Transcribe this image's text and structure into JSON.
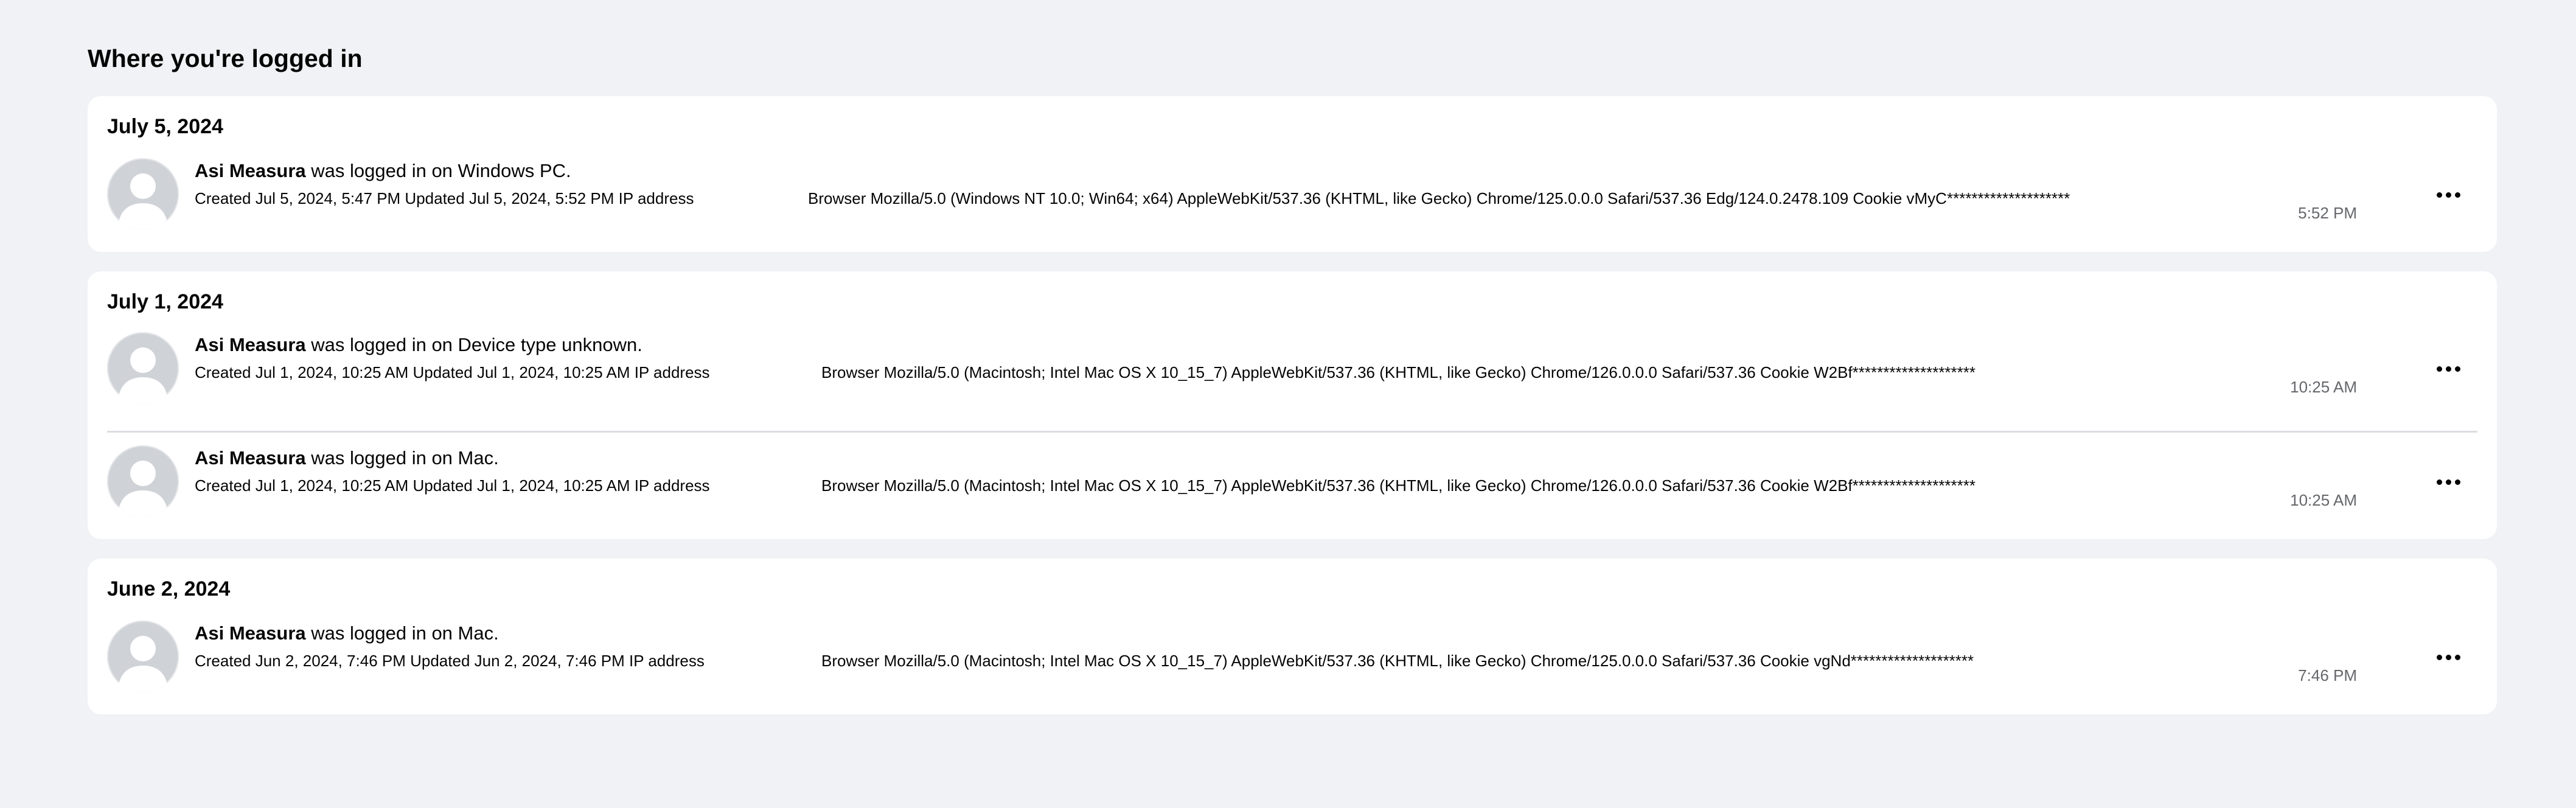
{
  "page": {
    "title": "Where you're logged in"
  },
  "groups": [
    {
      "date": "July 5, 2024",
      "sessions": [
        {
          "user": "Asi Measura",
          "action": " was logged in on Windows PC.",
          "meta": "Created Jul 5, 2024, 5:47 PM Updated Jul 5, 2024, 5:52 PM IP address",
          "browser": "Browser Mozilla/5.0 (Windows NT 10.0; Win64; x64) AppleWebKit/537.36 (KHTML, like Gecko) Chrome/125.0.0.0 Safari/537.36 Edg/124.0.2478.109 Cookie vMyC********************",
          "time": "5:52 PM"
        }
      ]
    },
    {
      "date": "July 1, 2024",
      "sessions": [
        {
          "user": "Asi Measura",
          "action": " was logged in on Device type unknown.",
          "meta": "Created Jul 1, 2024, 10:25 AM Updated Jul 1, 2024, 10:25 AM IP address",
          "browser": "Browser Mozilla/5.0 (Macintosh; Intel Mac OS X 10_15_7) AppleWebKit/537.36 (KHTML, like Gecko) Chrome/126.0.0.0 Safari/537.36 Cookie W2Bf********************",
          "time": "10:25 AM"
        },
        {
          "user": "Asi Measura",
          "action": " was logged in on Mac.",
          "meta": "Created Jul 1, 2024, 10:25 AM Updated Jul 1, 2024, 10:25 AM IP address",
          "browser": "Browser Mozilla/5.0 (Macintosh; Intel Mac OS X 10_15_7) AppleWebKit/537.36 (KHTML, like Gecko) Chrome/126.0.0.0 Safari/537.36 Cookie W2Bf********************",
          "time": "10:25 AM"
        }
      ]
    },
    {
      "date": "June 2, 2024",
      "sessions": [
        {
          "user": "Asi Measura",
          "action": " was logged in on Mac.",
          "meta": "Created Jun 2, 2024, 7:46 PM Updated Jun 2, 2024, 7:46 PM IP address",
          "browser": "Browser Mozilla/5.0 (Macintosh; Intel Mac OS X 10_15_7) AppleWebKit/537.36 (KHTML, like Gecko) Chrome/125.0.0.0 Safari/537.36 Cookie vgNd********************",
          "time": "7:46 PM"
        }
      ]
    }
  ]
}
